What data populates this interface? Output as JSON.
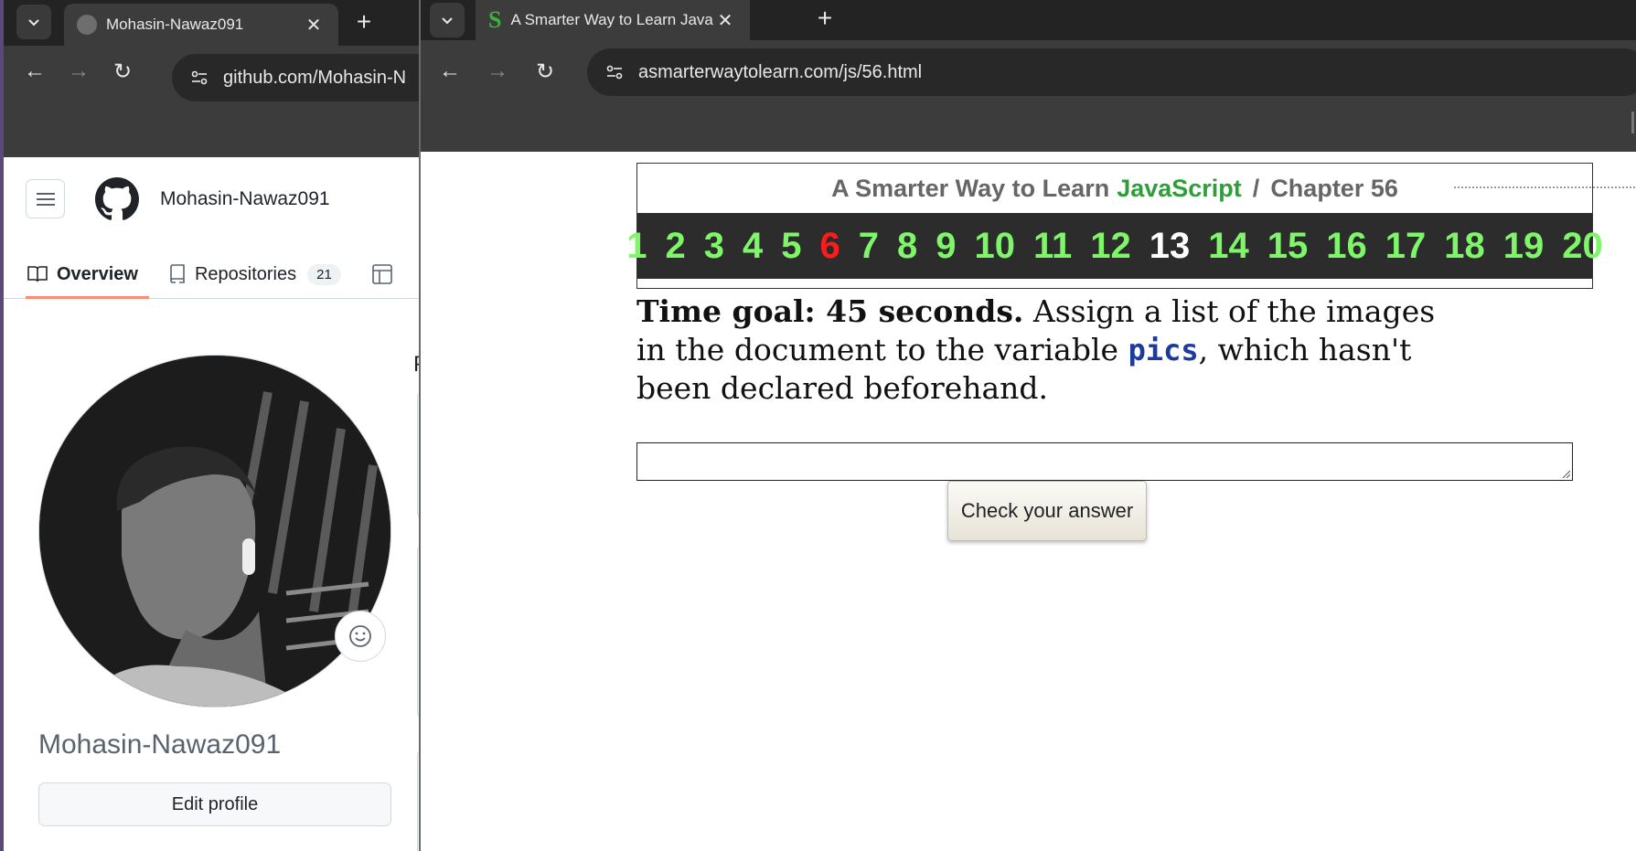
{
  "left_window": {
    "tab": {
      "title": "Mohasin-Nawaz091"
    },
    "omnibox": {
      "url": "github.com/Mohasin-N"
    },
    "github": {
      "username": "Mohasin-Nawaz091",
      "tabs": [
        {
          "label": "Overview",
          "active": true
        },
        {
          "label": "Repositories",
          "count": "21"
        }
      ],
      "profile_name": "Mohasin-Nawaz091",
      "edit_profile_label": "Edit profile",
      "pinned_letter": "P"
    }
  },
  "right_window": {
    "tab": {
      "title": "A Smarter Way to Learn JavaScr",
      "favicon_letter": "S"
    },
    "omnibox": {
      "url": "asmarterwaytolearn.com/js/56.html"
    },
    "page": {
      "book_title_prefix": "A Smarter Way to Learn",
      "book_title_js": "JavaScript",
      "separator": "/",
      "chapter_label": "Chapter 56",
      "chapters": [
        {
          "n": "1",
          "state": "normal"
        },
        {
          "n": "2",
          "state": "normal"
        },
        {
          "n": "3",
          "state": "normal"
        },
        {
          "n": "4",
          "state": "normal"
        },
        {
          "n": "5",
          "state": "normal"
        },
        {
          "n": "6",
          "state": "red"
        },
        {
          "n": "7",
          "state": "normal"
        },
        {
          "n": "8",
          "state": "normal"
        },
        {
          "n": "9",
          "state": "normal"
        },
        {
          "n": "10",
          "state": "normal"
        },
        {
          "n": "11",
          "state": "normal"
        },
        {
          "n": "12",
          "state": "normal"
        },
        {
          "n": "13",
          "state": "current"
        },
        {
          "n": "14",
          "state": "normal"
        },
        {
          "n": "15",
          "state": "normal"
        },
        {
          "n": "16",
          "state": "normal"
        },
        {
          "n": "17",
          "state": "normal"
        },
        {
          "n": "18",
          "state": "normal"
        },
        {
          "n": "19",
          "state": "normal"
        },
        {
          "n": "20",
          "state": "normal"
        }
      ],
      "time_goal": "Time goal: 45 seconds.",
      "instruction_part1": " Assign a list of the images in the document to the variable ",
      "code_var": "pics",
      "instruction_part2": ", which hasn't been declared beforehand.",
      "answer_value": "",
      "check_button_label": "Check your answer"
    }
  },
  "colors": {
    "chapter_green": "#7ff56a",
    "chapter_red": "#ff1b1b",
    "js_green": "#2e9e3a",
    "code_blue": "#1d3a9e",
    "github_active_underline": "#fd8c73"
  }
}
